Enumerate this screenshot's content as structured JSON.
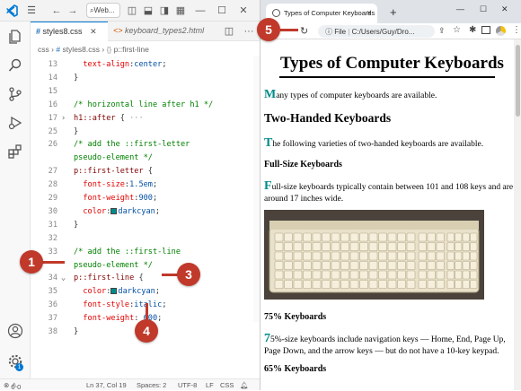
{
  "vscode": {
    "search_text": "Web...",
    "tabs": [
      {
        "label": "styles8.css"
      },
      {
        "label": "keyboard_types2.html"
      }
    ],
    "breadcrumb": [
      "css",
      "styles8.css",
      "p::first-line"
    ],
    "lines": [
      {
        "n": "13",
        "code": "  text-align:center;"
      },
      {
        "n": "14",
        "code": "}"
      },
      {
        "n": "15",
        "code": ""
      },
      {
        "n": "16",
        "code": "/* horizontal line after h1 */"
      },
      {
        "n": "17",
        "code": "h1::after {···"
      },
      {
        "n": "25",
        "code": "}"
      },
      {
        "n": "26",
        "code": "/* add the ::first-letter"
      },
      {
        "n": "",
        "code": "pseudo-element */"
      },
      {
        "n": "27",
        "code": "p::first-letter {"
      },
      {
        "n": "28",
        "code": "  font-size:1.5em;"
      },
      {
        "n": "29",
        "code": "  font-weight:900;"
      },
      {
        "n": "30",
        "code": "  color:darkcyan;"
      },
      {
        "n": "31",
        "code": "}"
      },
      {
        "n": "32",
        "code": ""
      },
      {
        "n": "33",
        "code": "/* add the ::first-line"
      },
      {
        "n": "",
        "code": "pseudo-element */"
      },
      {
        "n": "34",
        "code": "p::first-line {"
      },
      {
        "n": "35",
        "code": "  color:darkcyan;"
      },
      {
        "n": "36",
        "code": "  font-style:italic;"
      },
      {
        "n": "37",
        "code": "  font-weight: 600;"
      },
      {
        "n": "38",
        "code": "}"
      }
    ],
    "status": {
      "errors": "0",
      "warnings": "0",
      "position": "Ln 37, Col 19",
      "spaces": "Spaces: 2",
      "encoding": "UTF-8",
      "eol": "LF",
      "language": "CSS"
    },
    "badge_count": "1"
  },
  "browser": {
    "tab_title": "Types of Computer Keyboards",
    "file_label": "File",
    "url": "C:/Users/Guy/Dro...",
    "page": {
      "h1": "Types of Computer Keyboards",
      "p1_first": "M",
      "p1_rest": "any types of computer keyboards are available.",
      "h2": "Two-Handed Keyboards",
      "p2_first": "T",
      "p2_rest": "he following varieties of two-handed keyboards are available.",
      "h3_full": "Full-Size Keyboards",
      "p3_first": "F",
      "p3_rest_1": "ull-size keyboards typically contain between 101 and 108 keys and are",
      "p3_line2": "around 17 inches wide.",
      "h3_75": "75% Keyboards",
      "p4_first": "7",
      "p4_rest_1": "5%-size keyboards include navigation keys — Home, End, Page Up,",
      "p4_line2": "Page Down, and the arrow keys — but do not have a 10-key keypad.",
      "h3_65": "65% Keyboards"
    }
  },
  "callouts": [
    "1",
    "3",
    "4",
    "5"
  ],
  "colors": {
    "accent": "#0078d4",
    "callout": "#c0392b",
    "darkcyan": "#008b8b"
  }
}
